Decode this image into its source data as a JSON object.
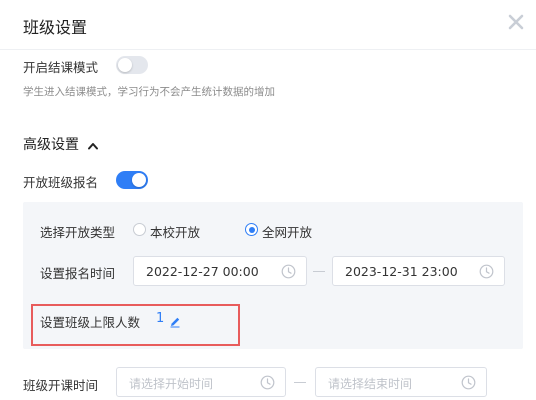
{
  "dialog": {
    "title": "班级设置"
  },
  "end_class_mode": {
    "label": "开启结课模式",
    "enabled": false,
    "hint": "学生进入结课模式，学习行为不会产生统计数据的增加"
  },
  "advanced": {
    "title": "高级设置",
    "open_enrollment": {
      "label": "开放班级报名",
      "enabled": true
    },
    "open_type": {
      "label": "选择开放类型",
      "options": [
        "本校开放",
        "全网开放"
      ],
      "selected": "全网开放"
    },
    "enroll_time": {
      "label": "设置报名时间",
      "start": "2022-12-27 00:00",
      "end": "2023-12-31 23:00"
    },
    "max_students": {
      "label": "设置班级上限人数",
      "value": "1"
    }
  },
  "class_time": {
    "label": "班级开课时间",
    "start_placeholder": "请选择开始时间",
    "end_placeholder": "请选择结束时间"
  },
  "colors": {
    "accent": "#2f7ef6",
    "highlight_border": "#e85c5c",
    "panel_bg": "#f4f6f9"
  }
}
